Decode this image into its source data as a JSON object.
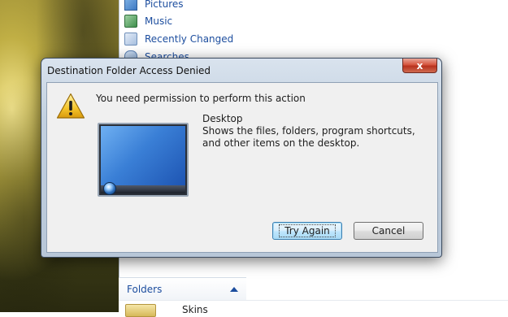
{
  "explorer": {
    "nav_items": [
      {
        "label": "Pictures",
        "icon": "pictures-icon"
      },
      {
        "label": "Music",
        "icon": "music-icon"
      },
      {
        "label": "Recently Changed",
        "icon": "recently-changed-icon"
      },
      {
        "label": "Searches",
        "icon": "searches-icon"
      }
    ],
    "folders_label": "Folders",
    "file_item_label": "Skins"
  },
  "dialog": {
    "title": "Destination Folder Access Denied",
    "close_label": "x",
    "message": "You need permission to perform this action",
    "item_name": "Desktop",
    "item_description": "Shows the files, folders, program shortcuts, and other items on the desktop.",
    "try_again_label": "Try Again",
    "cancel_label": "Cancel"
  },
  "colors": {
    "link_blue": "#1c4d9e",
    "close_red": "#c8452f",
    "default_button_border": "#3c7fb1"
  }
}
